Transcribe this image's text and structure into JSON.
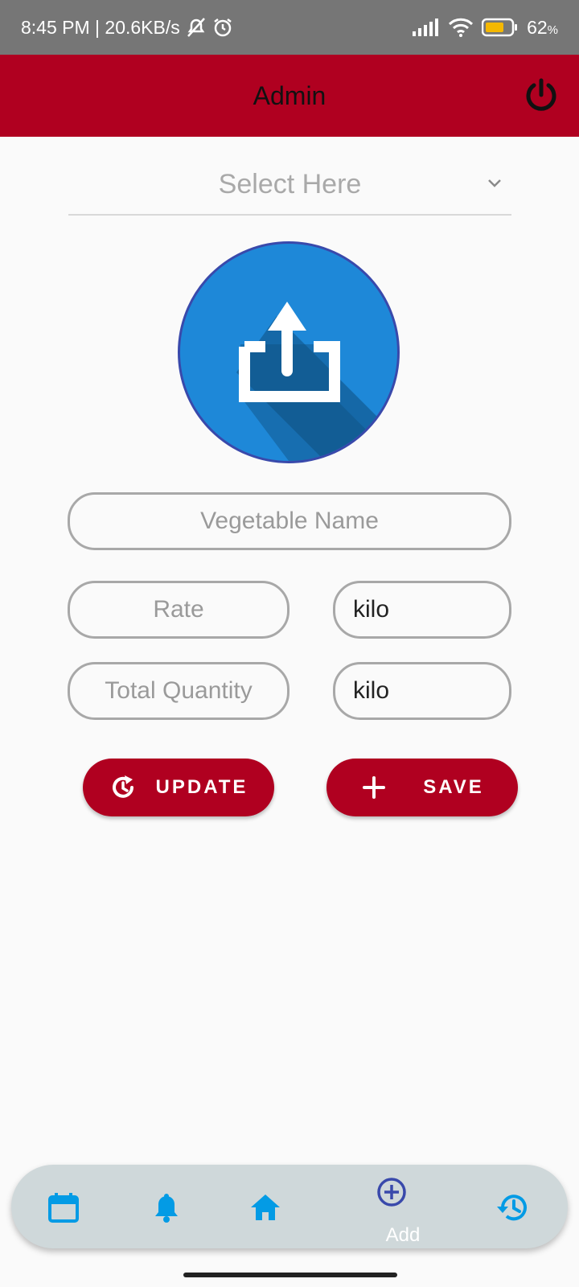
{
  "status_bar": {
    "time_speed": "8:45 PM | 20.6KB/s",
    "battery_pct": "62",
    "battery_unit": "%"
  },
  "appbar": {
    "title": "Admin"
  },
  "select": {
    "placeholder": "Select Here"
  },
  "form": {
    "vegetable_name_placeholder": "Vegetable Name",
    "rate_placeholder": "Rate",
    "rate_unit": "kilo",
    "total_quantity_placeholder": "Total Quantity",
    "quantity_unit": "kilo"
  },
  "buttons": {
    "update": "UPDATE",
    "save": "SAVE"
  },
  "nav": {
    "items": [
      "calendar-icon",
      "bell-icon",
      "home-icon",
      "add-circle-icon",
      "history-icon"
    ],
    "add_label": "Add"
  },
  "colors": {
    "primary": "#b00020",
    "nav_icon": "#039be5",
    "nav_active": "#3949ab",
    "upload_circle": "#1e88d8"
  }
}
